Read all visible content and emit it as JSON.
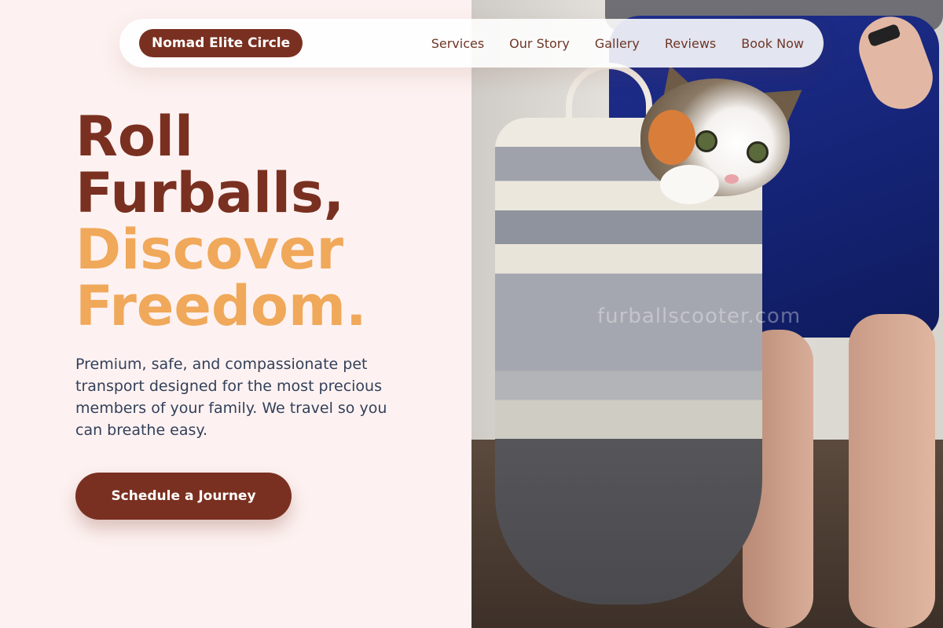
{
  "brand": {
    "name": "Nomad Elite Circle"
  },
  "nav": {
    "links": [
      "Services",
      "Our Story",
      "Gallery",
      "Reviews",
      "Book Now"
    ]
  },
  "hero": {
    "headline_line1": "Roll",
    "headline_line2": "Furballs,",
    "headline_line3": "Discover",
    "headline_line4": "Freedom.",
    "subtext": "Premium, safe, and compassionate pet transport designed for the most precious members of your family. We travel so you can breathe easy.",
    "cta_label": "Schedule a Journey"
  },
  "photo": {
    "watermark": "furballscooter.com"
  },
  "colors": {
    "primary": "#7a3020",
    "accent": "#f0a85a",
    "background": "#fdf2f1",
    "body_text": "#33405a"
  }
}
